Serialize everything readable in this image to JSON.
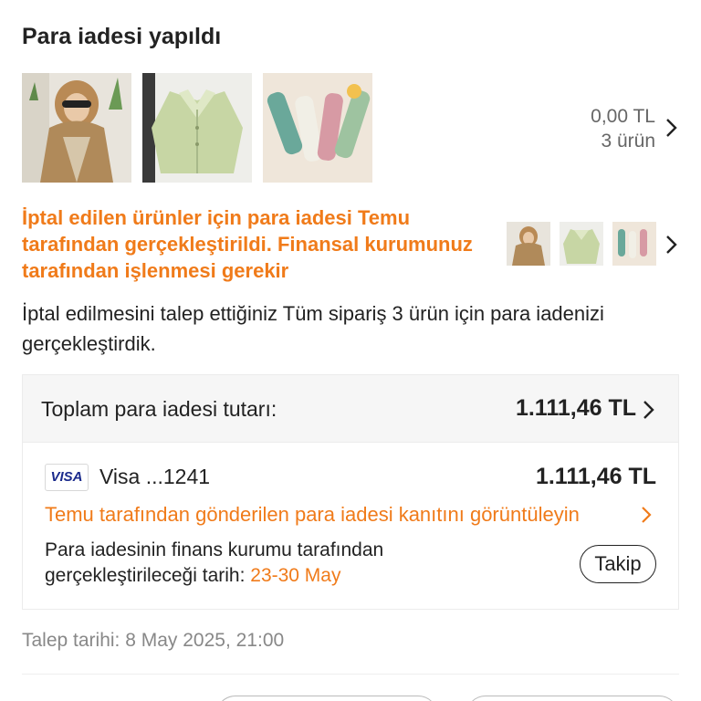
{
  "header": {
    "title": "Para iadesi yapıldı"
  },
  "items_summary": {
    "amount": "0,00 TL",
    "count": "3 ürün"
  },
  "refund_notice": {
    "message": "İptal edilen ürünler için para iadesi Temu tarafından gerçekleştirildi. Finansal kurumunuz tarafından işlenmesi gerekir",
    "description": "İptal edilmesini talep ettiğiniz Tüm sipariş 3 ürün için para iadenizi gerçekleştirdik."
  },
  "refund_card": {
    "total_label": "Toplam para iadesi tutarı:",
    "total_value": "1.111,46 TL",
    "payment_badge": "VISA",
    "payment_method": "Visa ...1241",
    "payment_amount": "1.111,46 TL",
    "proof_link": "Temu tarafından gönderilen para iadesi kanıtını görüntüleyin",
    "estimate_text": "Para iadesinin finans kurumu tarafından gerçekleştirileceği tarih: ",
    "estimate_date": "23-30 May",
    "follow_button": "Takip"
  },
  "request_date": "Talep tarihi: 8 May 2025, 21:00",
  "colors": {
    "accent": "#f07b1a",
    "text": "#222222",
    "muted": "#888888"
  },
  "icons": [
    "chevron-right-icon"
  ]
}
